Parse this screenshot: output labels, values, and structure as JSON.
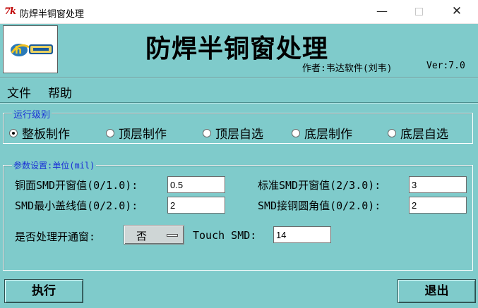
{
  "window": {
    "icon_text": "7k",
    "title": "防焊半铜窗处理",
    "controls": {
      "minimize": "—",
      "close": "✕"
    }
  },
  "header": {
    "logo_icon": "hdsoft-logo-icon",
    "heading": "防焊半铜窗处理",
    "author": "作者:韦达软件(刘韦)",
    "version": "Ver:7.0"
  },
  "menu": {
    "file": "文件",
    "help": "帮助"
  },
  "run_level": {
    "legend": "运行级别",
    "options": [
      "整板制作",
      "顶层制作",
      "顶层自选",
      "底层制作",
      "底层自选"
    ],
    "selected": "整板制作"
  },
  "params": {
    "legend": "参数设置:单位(mil)",
    "copper_smd_window": {
      "label": "铜面SMD开窗值(0/1.0):",
      "value": "0.5"
    },
    "std_smd_window": {
      "label": "标准SMD开窗值(2/3.0):",
      "value": "3"
    },
    "smd_min_cover": {
      "label": "SMD最小盖线值(0/2.0):",
      "value": "2"
    },
    "smd_copper_radius": {
      "label": "SMD接铜圆角值(0/2.0):",
      "value": "2"
    },
    "open_window": {
      "label": "是否处理开通窗:",
      "value": "否"
    },
    "touch_smd": {
      "label": "Touch SMD:",
      "value": "14"
    }
  },
  "actions": {
    "run": "执行",
    "exit": "退出"
  },
  "colors": {
    "panel": "#7fcbcb",
    "legend_text": "#1a2fd6",
    "icon_red": "#c00000"
  }
}
